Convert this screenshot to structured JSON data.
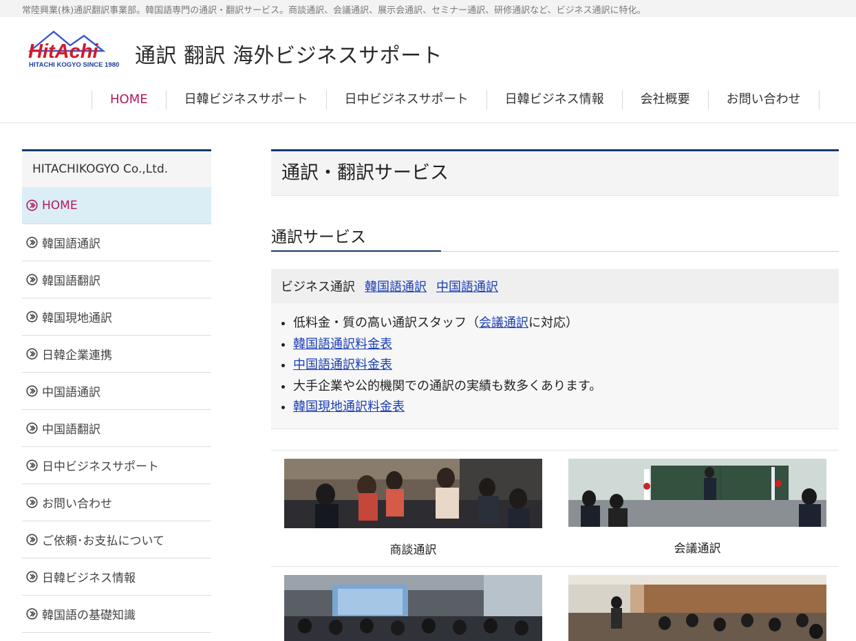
{
  "tagline": "常陸興業(株)通訳翻訳事業部。韓国語専門の通訳・翻訳サービス。商談通訳、会議通訳、展示会通訳、セミナー通訳、研修通訳など、ビジネス通訳に特化。",
  "logo": {
    "brand": "HitAchi",
    "sub": "HITACHI KOGYO SINCE 1980"
  },
  "site_title": "通訳 翻訳 海外ビジネスサポート",
  "nav": [
    "HOME",
    "日韓ビジネスサポート",
    "日中ビジネスサポート",
    "日韓ビジネス情報",
    "会社概要",
    "お問い合わせ"
  ],
  "sidebar": {
    "heading": "HITACHIKOGYO Co.,Ltd.",
    "items": [
      "HOME",
      "韓国語通訳",
      "韓国語翻訳",
      "韓国現地通訳",
      "日韓企業連携",
      "中国語通訳",
      "中国語翻訳",
      "日中ビジネスサポート",
      "お問い合わせ",
      "ご依頼･お支払について",
      "日韓ビジネス情報",
      "韓国語の基礎知識"
    ]
  },
  "main": {
    "page_title": "通訳・翻訳サービス",
    "section_title": "通訳サービス",
    "box": {
      "label": "ビジネス通訳",
      "links": [
        "韓国語通訳",
        "中国語通訳"
      ],
      "bullet1_pre": "低料金・質の高い通訳スタッフ（",
      "bullet1_link": "会議通訳",
      "bullet1_post": "に対応）",
      "bullet2_link": "韓国語通訳料金表",
      "bullet3_link": "中国語通訳料金表",
      "bullet4": "大手企業や公的機関での通訳の実績も数多くあります。",
      "bullet5_link": "韓国現地通訳料金表"
    },
    "cards": [
      {
        "caption": "商談通訳",
        "icon": "business-meeting-photo"
      },
      {
        "caption": "会議通訳",
        "icon": "conference-photo"
      },
      {
        "caption": "",
        "icon": "seminar-photo"
      },
      {
        "caption": "",
        "icon": "training-photo"
      }
    ]
  },
  "colors": {
    "accent": "#b5175f",
    "navy": "#14386b",
    "link": "#1a3db5",
    "active_bg": "#dbeef6"
  }
}
